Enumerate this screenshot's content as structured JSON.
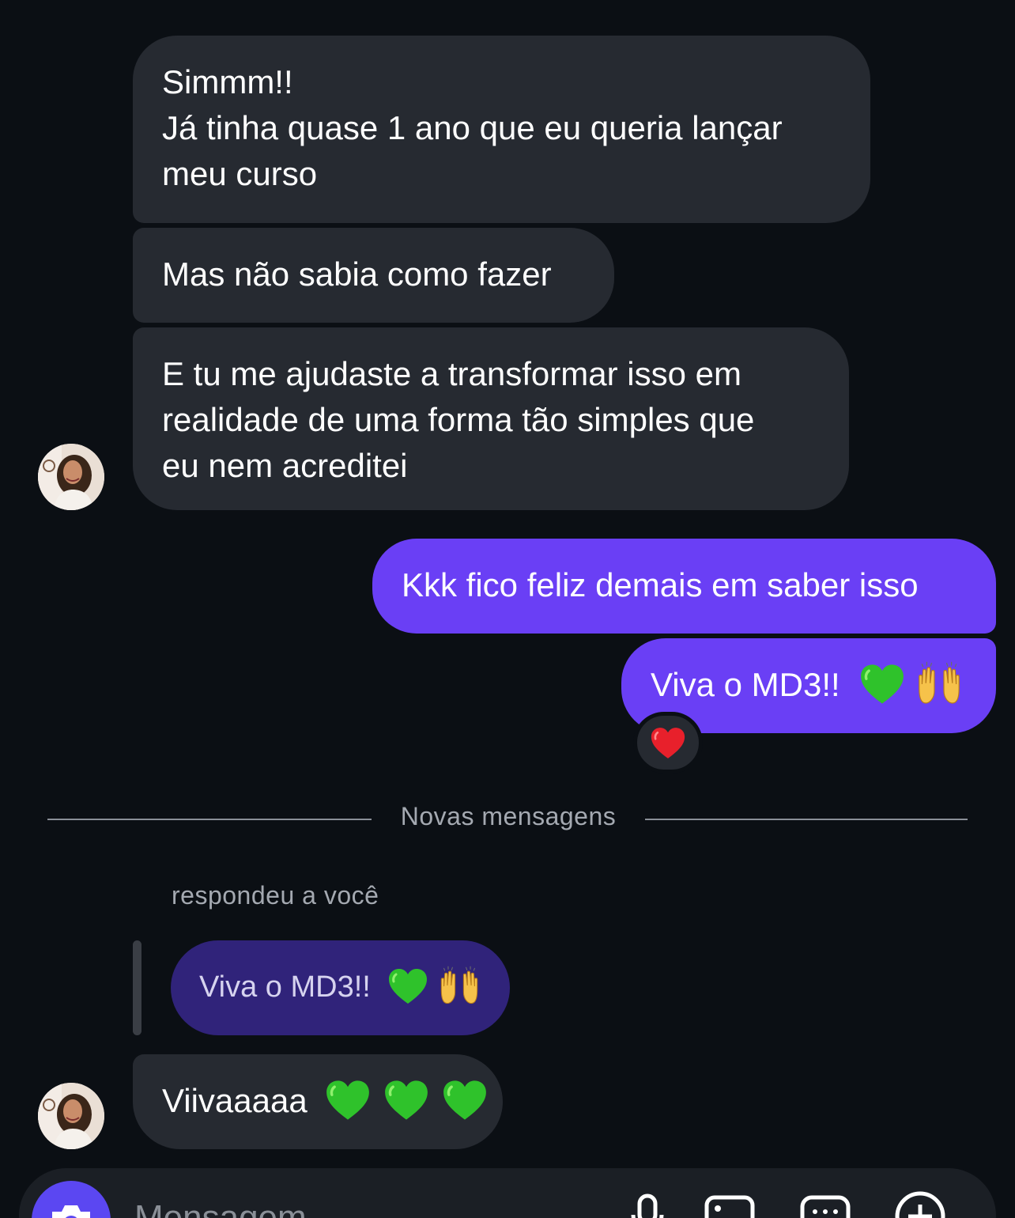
{
  "messages": {
    "m1_lines": [
      "Simmm!!",
      "Já tinha quase 1 ano que eu queria lançar",
      "meu curso"
    ],
    "m2": "Mas não sabia como fazer",
    "m3_lines": [
      "E tu me ajudaste a transformar isso em",
      "realidade de uma forma tão simples que",
      "eu nem acreditei"
    ],
    "m4": "Kkk fico feliz demais em saber isso",
    "m5_text": "Viva o MD3!!",
    "m6_text": "Viivaaaaa"
  },
  "reaction": {
    "emoji": "heart",
    "color": "#e8202b"
  },
  "divider": {
    "label": "Novas mensagens"
  },
  "reply": {
    "label": "respondeu a você",
    "quoted_text": "Viva o MD3!!"
  },
  "composer": {
    "placeholder": "Mensagem"
  },
  "icons": {
    "green_heart": "green-heart-icon",
    "raising_hands": "raising-hands-icon",
    "red_heart": "red-heart-icon",
    "camera": "camera-icon",
    "mic": "microphone-icon",
    "image": "image-icon",
    "sticker": "sticker-icon",
    "plus": "plus-icon"
  },
  "colors": {
    "background": "#0b0f14",
    "incoming_bubble": "#262a31",
    "outgoing_bubble": "#6a3ff5",
    "quoted_bubble": "#30237a",
    "green_heart": "#2fc22b"
  }
}
